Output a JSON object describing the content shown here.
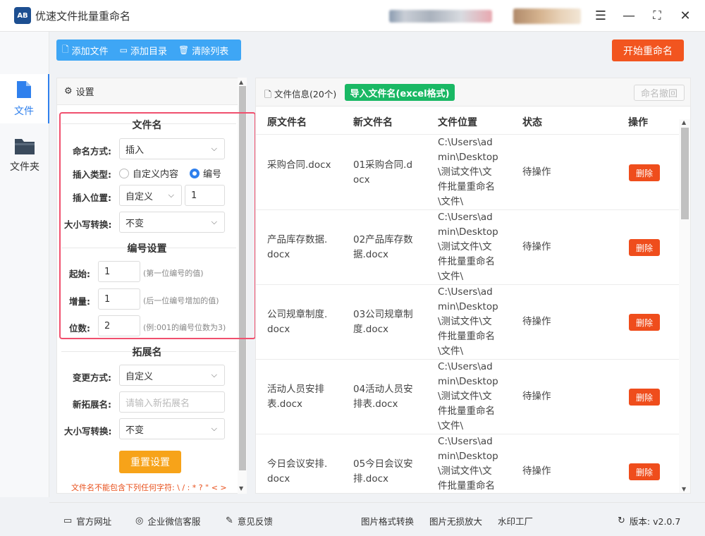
{
  "app": {
    "logo_text": "AB",
    "title": "优速文件批量重命名"
  },
  "window_controls": {
    "menu": "☰",
    "minimize": "—",
    "maximize": "⛶",
    "close": "✕"
  },
  "rail": [
    {
      "label": "文件",
      "icon": "file-icon",
      "active": true
    },
    {
      "label": "文件夹",
      "icon": "folder-icon",
      "active": false
    }
  ],
  "toolbar": {
    "add_file": "添加文件",
    "add_dir": "添加目录",
    "clear_list": "清除列表",
    "start": "开始重命名"
  },
  "settings": {
    "header": "设置",
    "filename_section": "文件名",
    "naming_label": "命名方式:",
    "naming_value": "插入",
    "insert_type_label": "插入类型:",
    "insert_type_options": [
      "自定义内容",
      "编号"
    ],
    "insert_type_selected": "编号",
    "insert_pos_label": "插入位置:",
    "insert_pos_value": "自定义",
    "insert_pos_number": "1",
    "case_label": "大小写转换:",
    "case_value": "不变",
    "number_section": "编号设置",
    "start_label": "起始:",
    "start_value": "1",
    "start_hint": "(第一位编号的值)",
    "step_label": "增量:",
    "step_value": "1",
    "step_hint": "(后一位编号增加的值)",
    "digits_label": "位数:",
    "digits_value": "2",
    "digits_hint": "(例:001的编号位数为3)",
    "ext_section": "拓展名",
    "ext_mode_label": "变更方式:",
    "ext_mode_value": "自定义",
    "new_ext_label": "新拓展名:",
    "new_ext_placeholder": "请输入新拓展名",
    "ext_case_label": "大小写转换:",
    "ext_case_value": "不变",
    "reset": "重置设置",
    "warning": "文件名不能包含下列任何字符: \\ / : * ? \" < >"
  },
  "files": {
    "title": "文件信息(20个)",
    "import": "导入文件名(excel格式)",
    "undo": "命名撤回",
    "columns": [
      "原文件名",
      "新文件名",
      "文件位置",
      "状态",
      "操作"
    ],
    "rows": [
      {
        "orig": "采购合同.docx",
        "new": "01采购合同.docx",
        "path": "C:\\Users\\admin\\Desktop\\测试文件\\文件批量重命名\\文件\\",
        "status": "待操作",
        "action": "删除"
      },
      {
        "orig": "产品库存数据.docx",
        "new": "02产品库存数据.docx",
        "path": "C:\\Users\\admin\\Desktop\\测试文件\\文件批量重命名\\文件\\",
        "status": "待操作",
        "action": "删除"
      },
      {
        "orig": "公司规章制度.docx",
        "new": "03公司规章制度.docx",
        "path": "C:\\Users\\admin\\Desktop\\测试文件\\文件批量重命名\\文件\\",
        "status": "待操作",
        "action": "删除"
      },
      {
        "orig": "活动人员安排表.docx",
        "new": "04活动人员安排表.docx",
        "path": "C:\\Users\\admin\\Desktop\\测试文件\\文件批量重命名\\文件\\",
        "status": "待操作",
        "action": "删除"
      },
      {
        "orig": "今日会议安排.docx",
        "new": "05今日会议安排.docx",
        "path": "C:\\Users\\admin\\Desktop\\测试文件\\文件批量重命名\\文件\\",
        "status": "待操作",
        "action": "删除"
      }
    ]
  },
  "footer": {
    "website": "官方网址",
    "wechat": "企业微信客服",
    "feedback": "意见反馈",
    "img_convert": "图片格式转换",
    "img_enlarge": "图片无损放大",
    "watermark": "水印工厂",
    "version": "版本: v2.0.7"
  },
  "colors": {
    "accent": "#2f80ed",
    "toolbar": "#3ea6f5",
    "start": "#f2551f",
    "import": "#19b864",
    "reset": "#f7a319",
    "delete": "#ef4d1c",
    "highlight_box": "#f0506e"
  }
}
